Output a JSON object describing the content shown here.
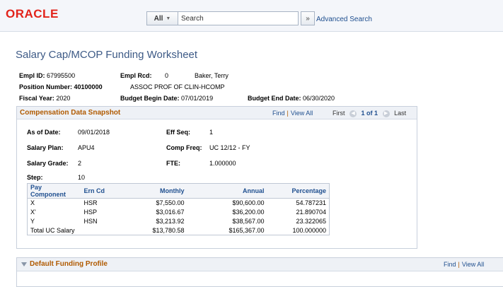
{
  "header": {
    "logo": "ORACLE",
    "search": {
      "scope": "All",
      "placeholder": "Search",
      "go_glyph": "»",
      "advanced": "Advanced Search"
    }
  },
  "page_title": "Salary Cap/MCOP Funding Worksheet",
  "employee": {
    "empl_id_label": "Empl ID:",
    "empl_id": "67995500",
    "empl_rcd_label": "Empl Rcd:",
    "empl_rcd": "0",
    "name": "Baker, Terry",
    "position_label": "Position Number:",
    "position": "40100000",
    "position_title": "ASSOC PROF OF CLIN-HCOMP",
    "fiscal_year_label": "Fiscal Year:",
    "fiscal_year": "2020",
    "budget_begin_label": "Budget Begin Date:",
    "budget_begin": "07/01/2019",
    "budget_end_label": "Budget End Date:",
    "budget_end": "06/30/2020"
  },
  "snapshot": {
    "title": "Compensation Data Snapshot",
    "nav": {
      "find": "Find",
      "sep": "|",
      "view_all": "View All",
      "first": "First",
      "count": "1 of 1",
      "last": "Last"
    },
    "as_of_label": "As of Date:",
    "as_of": "09/01/2018",
    "eff_seq_label": "Eff Seq:",
    "eff_seq": "1",
    "salary_plan_label": "Salary Plan:",
    "salary_plan": "APU4",
    "comp_freq_label": "Comp Freq:",
    "comp_freq": "UC 12/12 - FY",
    "salary_grade_label": "Salary Grade:",
    "salary_grade": "2",
    "fte_label": "FTE:",
    "fte": "1.000000",
    "step_label": "Step:",
    "step": "10",
    "table": {
      "headers": [
        "Pay Component",
        "Ern Cd",
        "Monthly",
        "Annual",
        "Percentage"
      ],
      "rows": [
        [
          "X",
          "HSR",
          "$7,550.00",
          "$90,600.00",
          "54.787231"
        ],
        [
          "X'",
          "HSP",
          "$3,016.67",
          "$36,200.00",
          "21.890704"
        ],
        [
          "Y",
          "HSN",
          "$3,213.92",
          "$38,567.00",
          "23.322065"
        ],
        [
          "Total UC Salary",
          "",
          "$13,780.58",
          "$165,367.00",
          "100.000000"
        ]
      ]
    }
  },
  "funding": {
    "title": "Default Funding Profile",
    "find": "Find",
    "sep": "|",
    "view_all": "View All"
  },
  "colors": {
    "title_blue": "#3d5a86",
    "section_orange": "#b05a00",
    "link_blue": "#1f4f8f",
    "oracle_red": "#e2231a"
  }
}
